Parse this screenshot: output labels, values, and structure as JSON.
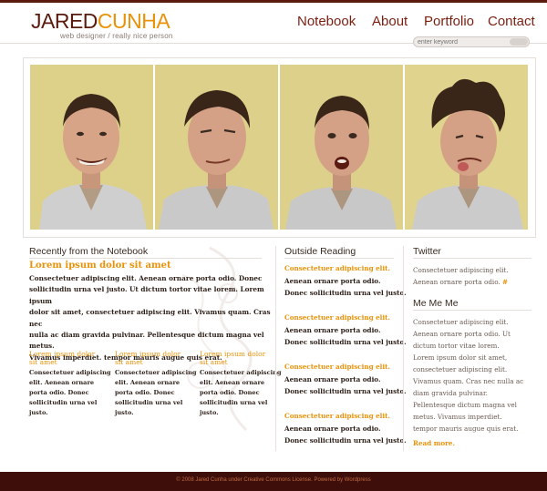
{
  "brand": {
    "first": "JARED",
    "last": "CUNHA",
    "tagline": "web designer / really nice person"
  },
  "nav": [
    "Notebook",
    "About",
    "Portfolio",
    "Contact"
  ],
  "search": {
    "placeholder": "enter keyword"
  },
  "photos": [
    "grinning-face-photo",
    "smirking-face-photo",
    "surprised-face-photo",
    "tongue-out-face-photo"
  ],
  "notebook": {
    "heading": "Recently from the Notebook",
    "feature": {
      "title": "Lorem ipsum dolor sit amet",
      "lines": [
        "Consectetuer adipiscing elit. Aenean ornare porta odio. Donec",
        "sollicitudin urna vel justo. Ut dictum tortor vitae lorem. Lorem ipsum",
        "dolor sit amet, consectetuer adipiscing elit. Vivamus quam. Cras nec",
        "nulla ac diam gravida pulvinar. Pellentesque dictum magna vel metus.",
        "Vivamus imperdiet. tempor mauris augue quis erat."
      ]
    },
    "posts": [
      {
        "title_1": "Lorem ipsum dolor",
        "title_2": "sit amet",
        "lines": [
          "Consectetuer adipiscing",
          "elit. Aenean ornare",
          "porta odio. Donec",
          "sollicitudin urna vel",
          "justo."
        ]
      },
      {
        "title_1": "Lorem ipsum dolor",
        "title_2": "sit amet",
        "lines": [
          "Consectetuer adipiscing",
          "elit. Aenean ornare",
          "porta odio. Donec",
          "sollicitudin urna vel",
          "justo."
        ]
      },
      {
        "title_1": "Lorem ipsum dolor",
        "title_2": "sit amet",
        "lines": [
          "Consectetuer adipiscing",
          "elit. Aenean ornare",
          "porta odio. Donec",
          "sollicitudin urna vel",
          "justo."
        ]
      }
    ]
  },
  "outside": {
    "heading": "Outside Reading",
    "items": [
      {
        "link": "Consectetuer adipiscing elit.",
        "line1": "Aenean ornare porta odio.",
        "line2": "Donec sollicitudin urna vel justo."
      },
      {
        "link": "Consectetuer adipiscing elit.",
        "line1": "Aenean ornare porta odio.",
        "line2": "Donec sollicitudin urna vel justo."
      },
      {
        "link": "Consectetuer adipiscing elit.",
        "line1": "Aenean ornare porta odio.",
        "line2": "Donec sollicitudin urna vel justo."
      },
      {
        "link": "Consectetuer adipiscing elit.",
        "line1": "Aenean ornare porta odio.",
        "line2": "Donec sollicitudin urna vel justo."
      }
    ]
  },
  "twitter": {
    "heading": "Twitter",
    "line1": "Consectetuer adipiscing elit.",
    "line2": "Aenean ornare porta odio.",
    "hash": "#"
  },
  "me": {
    "heading": "Me Me Me",
    "lines": [
      "Consectetuer adipiscing elit.",
      "Aenean ornare porta odio. Ut",
      "dictum tortor vitae lorem.",
      "Lorem ipsum dolor sit amet,",
      "consectetuer adipiscing elit.",
      "Vivamus quam. Cras nec nulla ac",
      "diam gravida pulvinar.",
      "Pellentesque dictum magna vel",
      "metus. Vivamus imperdiet.",
      "tempor mauris augue quis erat."
    ],
    "read_more": "Read more."
  },
  "footer": "© 2008 Jared Cunha  under Creative Commons License. Powered by Wordpress",
  "colors": {
    "brand_dark": "#5a1a0e",
    "accent": "#e8920a",
    "footer_bg": "#3d0e0a"
  }
}
